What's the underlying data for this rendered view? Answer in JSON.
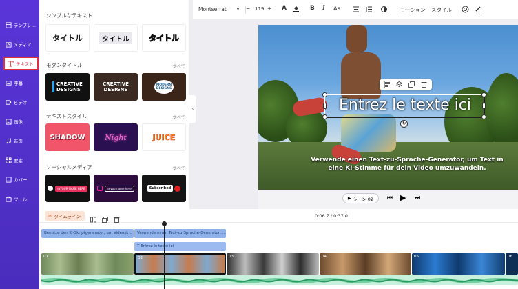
{
  "sidebar": {
    "items": [
      {
        "icon": "template-icon",
        "label": "テンプレ..."
      },
      {
        "icon": "media-icon",
        "label": "メディア"
      },
      {
        "icon": "text-icon",
        "label": "テキスト"
      },
      {
        "icon": "subtitle-icon",
        "label": "字幕"
      },
      {
        "icon": "video-icon",
        "label": "ビデオ"
      },
      {
        "icon": "image-icon",
        "label": "画像"
      },
      {
        "icon": "audio-icon",
        "label": "音声"
      },
      {
        "icon": "elements-icon",
        "label": "要素"
      },
      {
        "icon": "cover-icon",
        "label": "カバー"
      },
      {
        "icon": "tools-icon",
        "label": "ツール"
      }
    ],
    "active_index": 2
  },
  "panel": {
    "simple_title": "シンプルなテキスト",
    "simple_cards": [
      "タイトル",
      "タイトル",
      "タイトル"
    ],
    "modern_title": "モダンタイトル",
    "modern_all": "すべて",
    "modern_cards": [
      "CREATIVE DESIGNS",
      "CREATIVE DESIGNS",
      "MODERN DESIGNS"
    ],
    "style_title": "テキストスタイル",
    "style_all": "すべて",
    "style_cards": [
      "SHADOW",
      "Night",
      "JUICE"
    ],
    "social_title": "ソーシャルメディア",
    "social_all": "すべて",
    "social_cards": [
      "@YOUR NAME HERE",
      "@yourname here",
      "Subscribed"
    ]
  },
  "toolbar": {
    "font": "Montserrat",
    "font_size": "119",
    "minus": "−",
    "plus": "+",
    "motion": "モーション",
    "style": "スタイル"
  },
  "preview": {
    "textbox": "Entrez le texte ici",
    "caption_line1": "Verwende einen Text-zu-Sprache-Generator, um Text in",
    "caption_line2": "eine KI-Stimme für dein Video umzuwandeln."
  },
  "player": {
    "scene_label": "シーン 02"
  },
  "timeline": {
    "button": "タイムライン",
    "time": "0:06.7 / 0:37.0",
    "subtitle_clips": [
      "Benutze den KI-Skriptgenerator, um Videosk...",
      "Verwende einen Text-zu-Sprache-Generator, ..."
    ],
    "text_clip": "Entrez le texte ici",
    "scenes": [
      "01",
      "02",
      "03",
      "04",
      "05",
      "06"
    ]
  },
  "colors": {
    "rail": "#5a34d8",
    "accent_red": "#e0303c",
    "timeline_button": "#fbe3d6",
    "subtitle_clip": "#8fb2ea",
    "audio_track": "#c8f1dd"
  }
}
